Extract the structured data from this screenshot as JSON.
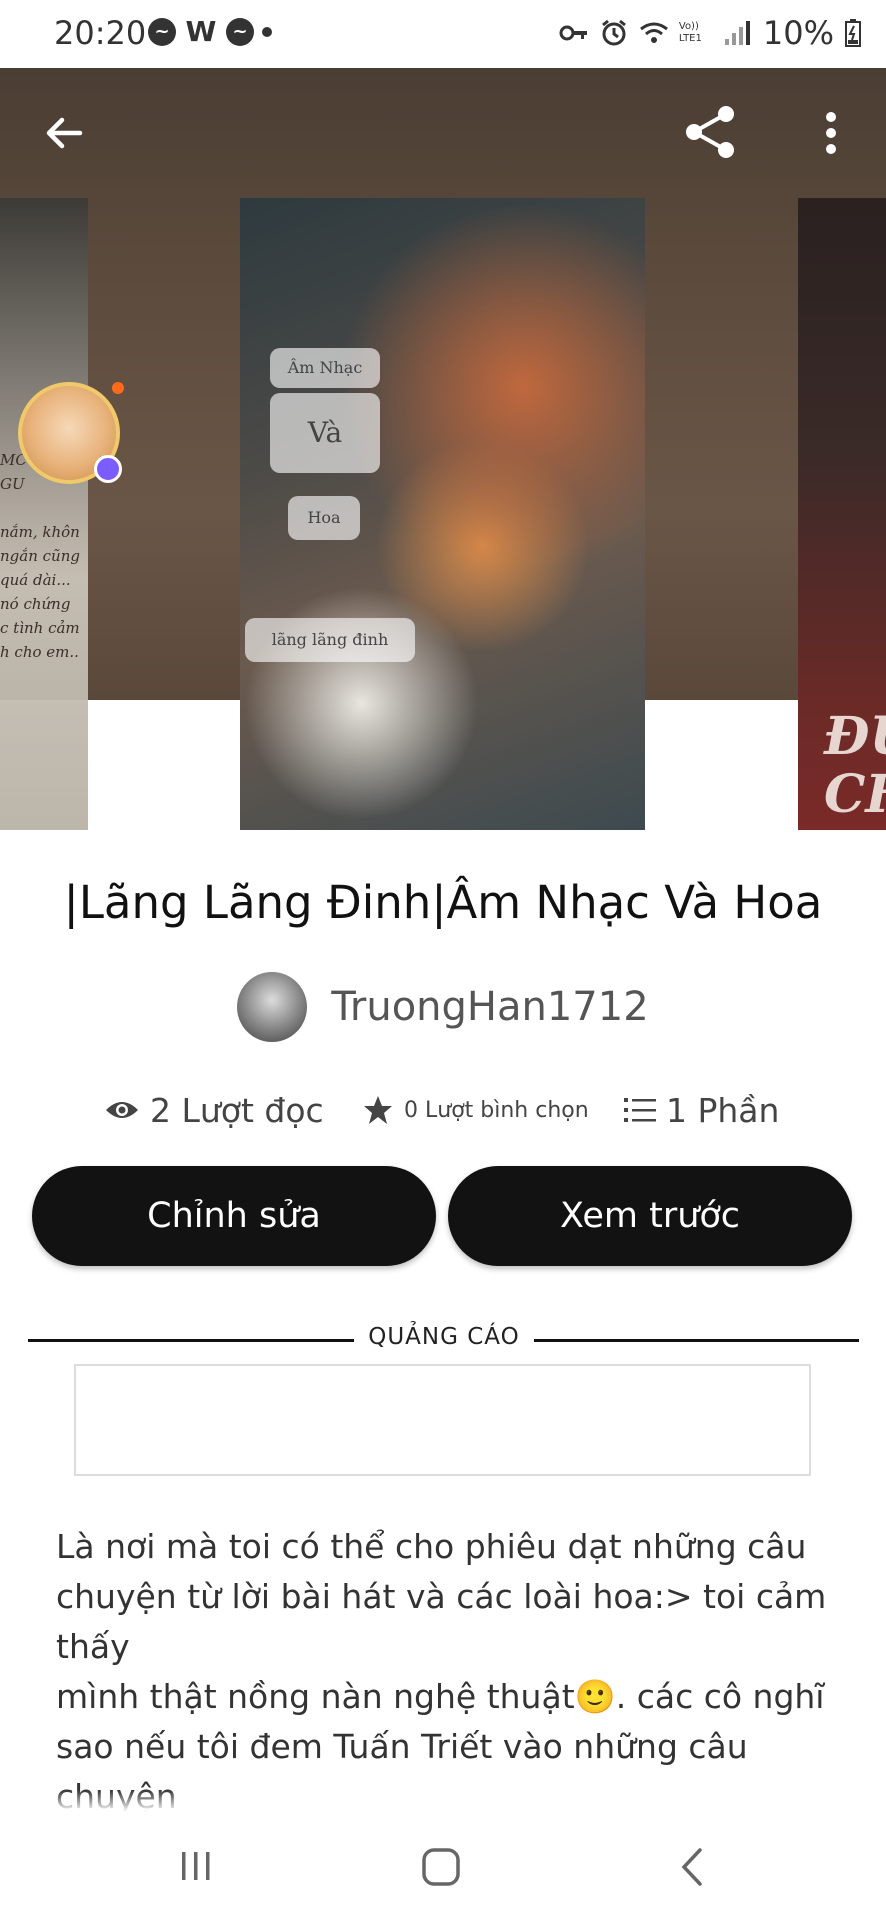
{
  "status_bar": {
    "time": "20:20",
    "battery": "10%",
    "notif_icons": [
      "messenger-icon",
      "wattpad-icon",
      "messenger-icon"
    ],
    "system_icons": [
      "vpn-key-icon",
      "alarm-icon",
      "wifi-icon",
      "lte-signal-icon",
      "battery-charging-icon"
    ],
    "lte_label": "Vo)) LTE1"
  },
  "toolbar": {
    "back_icon": "arrow-left-icon",
    "share_icon": "share-icon",
    "more_icon": "more-vertical-icon"
  },
  "cover": {
    "box1": "Âm Nhạc",
    "box2": "Và",
    "box3": "Hoa",
    "box4": "lãng lãng đinh"
  },
  "side_covers": {
    "left_text": "MC\nGU\n\nnắm, khôn\nngắn cũng\nquá dài...\nnó chứng\nc tình cảm\nh cho em..",
    "right_text": "ĐU\nCH"
  },
  "story": {
    "title": "|Lãng Lãng Đinh|Âm Nhạc Và Hoa",
    "author": "TruongHan1712",
    "reads": "2 Lượt đọc",
    "votes": "0 Lượt bình chọn",
    "parts": "1 Phần"
  },
  "actions": {
    "edit_label": "Chỉnh sửa",
    "preview_label": "Xem trước"
  },
  "ad": {
    "label": "QUẢNG CÁO"
  },
  "description": "Là nơi mà toi có thể cho phiêu dạt những câu\nchuyện từ lời bài hát và các loài hoa:> toi cảm thấy\nmình thật nồng nàn nghệ thuật🙂. các cô nghĩ\nsao nếu tôi đem Tuấn Triết vào những câu chuyện\nđó???\nẢnh bìa toi lấy từ blog của cô Chii:<",
  "colors": {
    "button_bg": "#121212",
    "bubble_dot": "#ff6a1a"
  }
}
